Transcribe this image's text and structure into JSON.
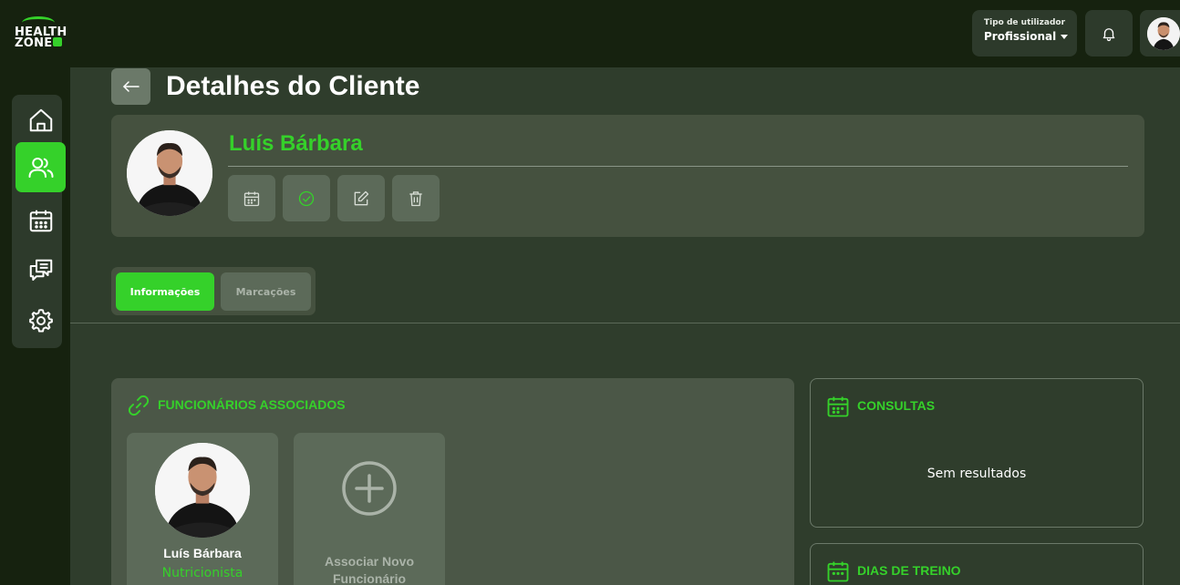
{
  "brand": {
    "logo_line1": "HEALTH",
    "logo_line2": "ZONE",
    "accent": "#35d12a"
  },
  "header": {
    "user_type_label": "Tipo de utilizador",
    "user_type_value": "Profissional",
    "notification_icon": "bell-icon",
    "avatar_icon": "user-avatar"
  },
  "sidebar": {
    "items": [
      {
        "name": "home",
        "icon": "home-icon",
        "active": false
      },
      {
        "name": "clients",
        "icon": "users-icon",
        "active": true
      },
      {
        "name": "calendar",
        "icon": "calendar-icon",
        "active": false
      },
      {
        "name": "messages",
        "icon": "chat-icon",
        "active": false
      },
      {
        "name": "settings",
        "icon": "gear-icon",
        "active": false
      }
    ]
  },
  "page": {
    "title": "Detalhes do Cliente",
    "back_icon": "arrow-left-icon"
  },
  "client": {
    "name": "Luís Bárbara",
    "actions": [
      "calendar-icon",
      "check-circle-icon",
      "edit-icon",
      "trash-icon"
    ]
  },
  "tabs": [
    {
      "label": "Informações",
      "active": true
    },
    {
      "label": "Marcações",
      "active": false
    }
  ],
  "staff": {
    "title": "FUNCIONÁRIOS ASSOCIADOS",
    "members": [
      {
        "name": "Luís Bárbara",
        "role": "Nutricionista"
      }
    ],
    "add_label": "Associar Novo Funcionário"
  },
  "consultas": {
    "title": "CONSULTAS",
    "empty": "Sem resultados"
  },
  "treino": {
    "title": "DIAS DE TREINO"
  }
}
